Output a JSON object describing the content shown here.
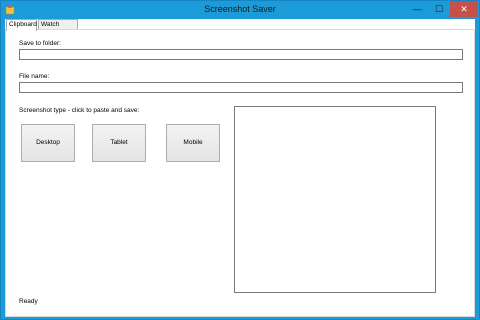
{
  "window": {
    "title": "Screenshot Saver",
    "controls": {
      "minimize": "—",
      "maximize": "☐",
      "close": "✕"
    }
  },
  "tabs": [
    {
      "label": "Clipboard",
      "active": true
    },
    {
      "label": "Watch folder",
      "active": false
    }
  ],
  "form": {
    "save_folder_label": "Save to folder:",
    "save_folder_value": "",
    "file_name_label": "File name:",
    "file_name_value": "",
    "type_label": "Screenshot type - click to paste and save:"
  },
  "buttons": {
    "desktop": "Desktop",
    "tablet": "Tablet",
    "mobile": "Mobile"
  },
  "status": "Ready",
  "colors": {
    "titlebar": "#1b9cd9",
    "close": "#c7504b"
  }
}
